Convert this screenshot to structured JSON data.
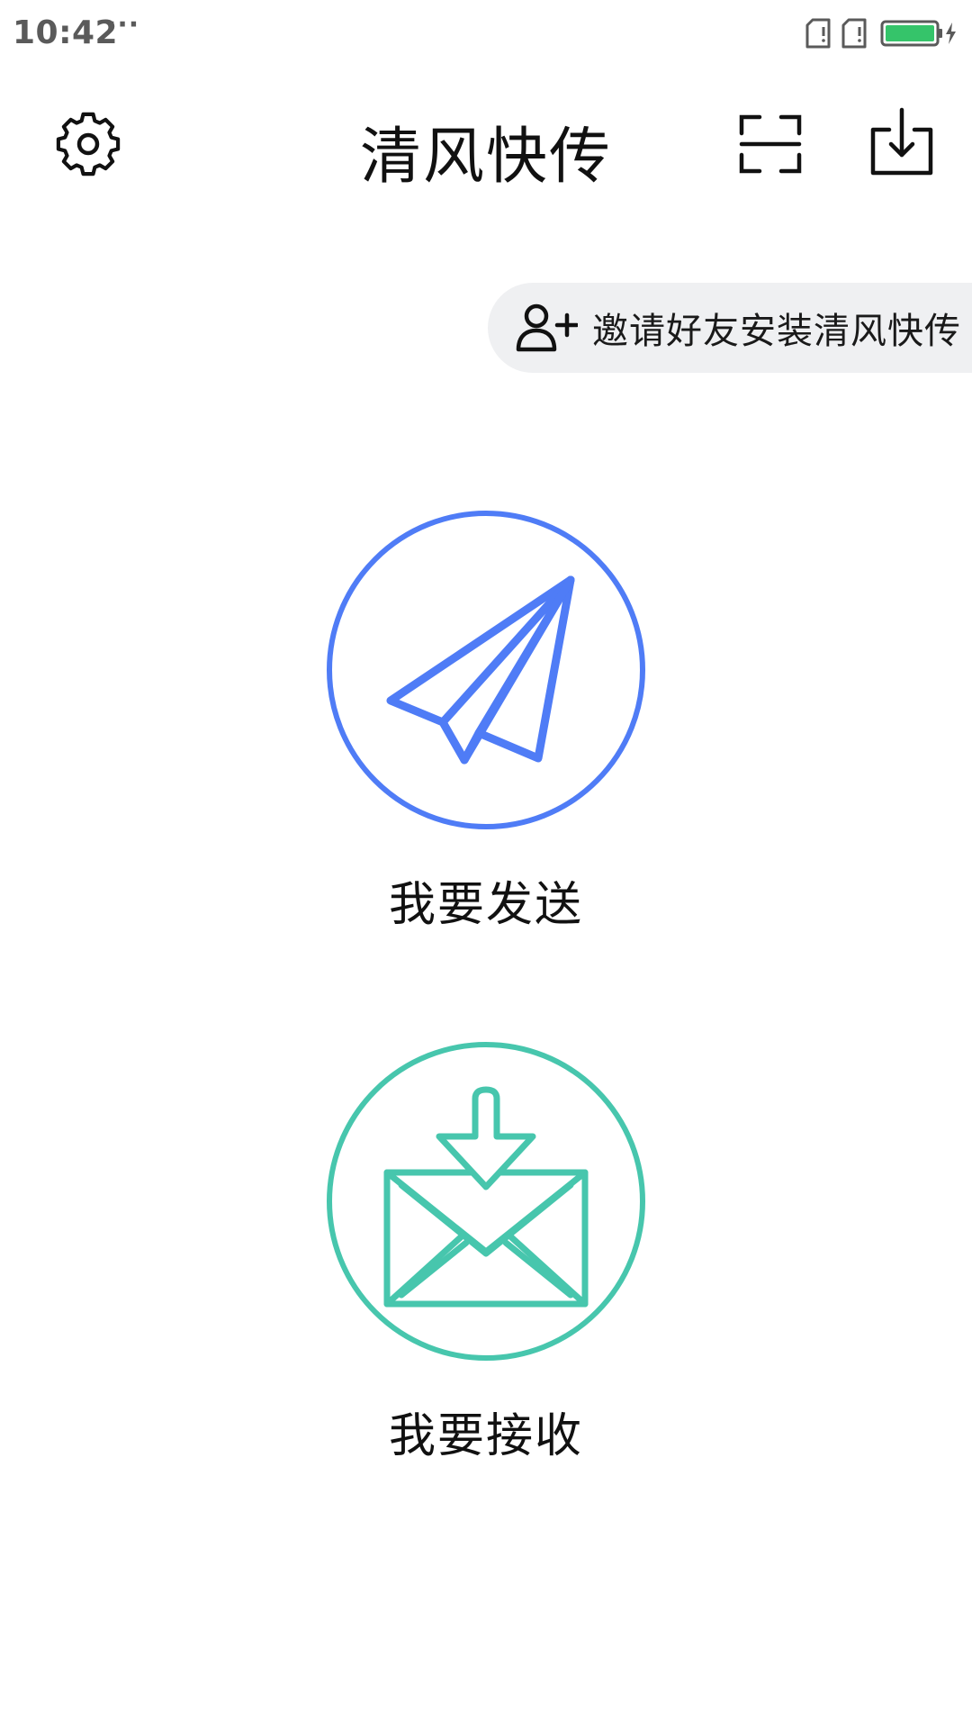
{
  "status_bar": {
    "time": "10:42",
    "more": "···",
    "icons": [
      "sim-card-icon",
      "sim-card-icon",
      "battery-charging-icon"
    ],
    "battery_color": "#35c46a"
  },
  "header": {
    "title": "清风快传",
    "left_icon": "gear-icon",
    "right_icons": [
      "scan-icon",
      "download-icon"
    ]
  },
  "invite": {
    "label": "邀请好友安装清风快传",
    "icon": "add-user-icon",
    "background": "#eff0f2"
  },
  "actions": [
    {
      "label": "我要发送",
      "icon": "paper-plane-icon",
      "color": "#4f7cf6"
    },
    {
      "label": "我要接收",
      "icon": "mail-download-icon",
      "color": "#47c6ad"
    }
  ]
}
